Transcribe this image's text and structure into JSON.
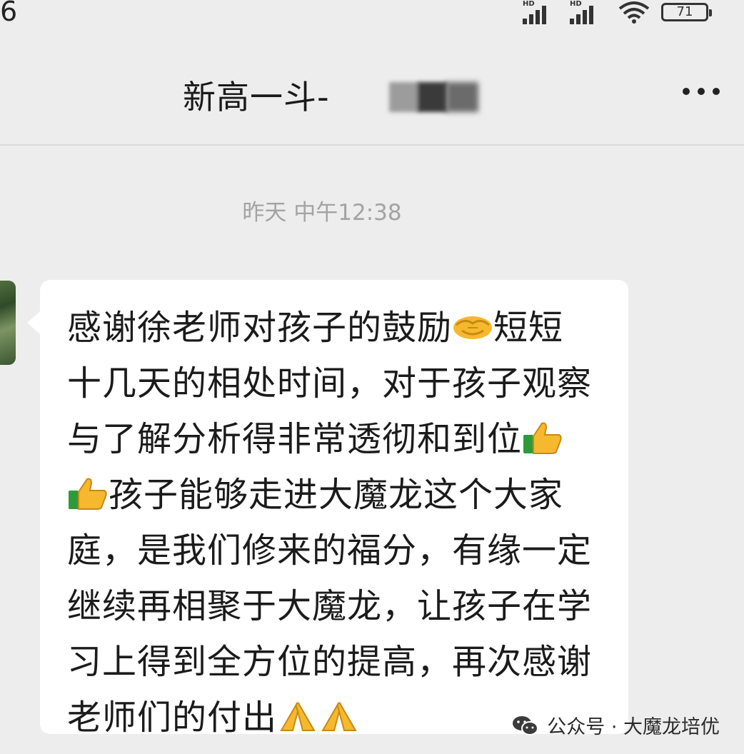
{
  "status_bar": {
    "time": "6",
    "network_1": "HD",
    "network_2": "HD",
    "battery": "71"
  },
  "header": {
    "title": "新高一斗-"
  },
  "chat": {
    "timestamp": "昨天 中午12:38",
    "message": {
      "lines": [
        {
          "before": "感谢徐老师对孩子的鼓励",
          "emoji": "handshake-icon",
          "after": "短短"
        },
        {
          "text": "十几天的相处时间，对于孩子观察"
        },
        {
          "before": "与了解分析得非常透彻和到位",
          "emoji": "thumbs-up-icon",
          "after": ""
        },
        {
          "before": "",
          "emoji": "thumbs-up-icon",
          "after": "孩子能够走进大魔龙这个大家"
        },
        {
          "text": "庭，是我们修来的福分，有缘一定"
        },
        {
          "text": "继续再相聚于大魔龙，让孩子在学"
        },
        {
          "text": "习上得到全方位的提高，再次感谢"
        },
        {
          "before": "老师们的付出",
          "emoji": "folded-hands-icon",
          "emoji2": "folded-hands-icon",
          "after": ""
        }
      ]
    }
  },
  "watermark": {
    "text": "公众号 · 大魔龙培优"
  },
  "colors": {
    "background": "#ededed",
    "bubble": "#ffffff",
    "timestamp": "#a3a3a3",
    "emoji_yellow": "#f5b82e"
  }
}
